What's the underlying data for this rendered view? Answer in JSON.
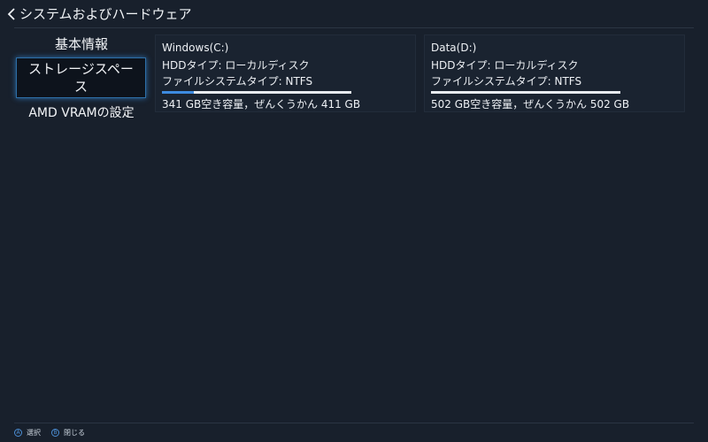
{
  "header": {
    "title": "システムおよびハードウェア"
  },
  "sidebar": {
    "items": [
      {
        "label": "基本情報",
        "selected": false
      },
      {
        "label": "ストレージスペース",
        "selected": true
      },
      {
        "label": "AMD VRAMの設定",
        "selected": false
      }
    ]
  },
  "drives": [
    {
      "name": "Windows(C:)",
      "hdd_type": "HDDタイプ: ローカルディスク",
      "fs_type": "ファイルシステムタイプ: NTFS",
      "used_fraction": 0.17,
      "capacity_text": "341 GB空き容量，ぜんくうかん 411 GB"
    },
    {
      "name": "Data(D:)",
      "hdd_type": "HDDタイプ: ローカルディスク",
      "fs_type": "ファイルシステムタイプ: NTFS",
      "used_fraction": 0.0,
      "capacity_text": "502 GB空き容量，ぜんくうかん 502 GB"
    }
  ],
  "footer": {
    "select_label": "選択",
    "select_key": "A",
    "close_label": "閉じる",
    "close_key": "B"
  },
  "colors": {
    "background": "#18202c",
    "accent": "#3d8be0",
    "bar_track": "#e7ebef"
  }
}
